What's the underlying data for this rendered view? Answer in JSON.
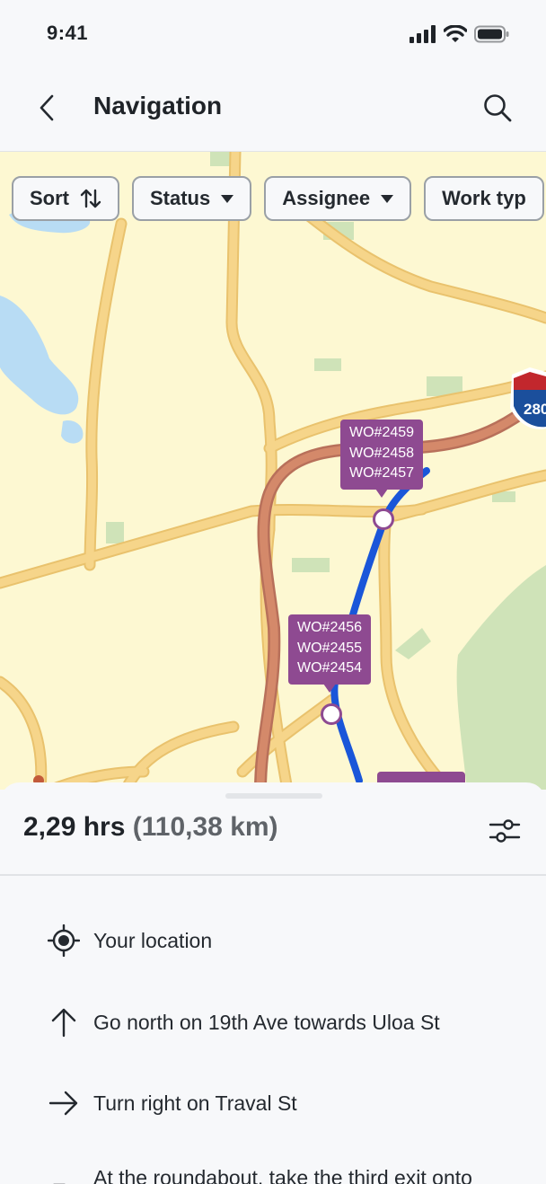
{
  "status_bar": {
    "time": "9:41"
  },
  "header": {
    "title": "Navigation"
  },
  "filters": [
    {
      "label": "Sort",
      "icon": "sort-arrows-icon"
    },
    {
      "label": "Status",
      "icon": "caret-down-icon"
    },
    {
      "label": "Assignee",
      "icon": "caret-down-icon"
    },
    {
      "label": "Work typ",
      "icon": "none"
    }
  ],
  "map": {
    "highway_shield": "280",
    "work_order_groups": [
      {
        "orders": [
          "WO#2459",
          "WO#2458",
          "WO#2457"
        ]
      },
      {
        "orders": [
          "WO#2456",
          "WO#2455",
          "WO#2454"
        ]
      }
    ],
    "colors": {
      "route": "#1a56d9",
      "traffic": "#d4896a",
      "marker": "#8e4a91",
      "land": "#fdf8d2",
      "water": "#b8dcf4",
      "park": "#cfe3b8",
      "road": "#f6d58a"
    }
  },
  "summary": {
    "duration": "2,29 hrs",
    "distance": "(110,38 km)"
  },
  "steps": [
    {
      "icon": "my-location-icon",
      "text": "Your location"
    },
    {
      "icon": "arrow-up-icon",
      "text": "Go north on 19th Ave towards Uloa St"
    },
    {
      "icon": "arrow-right-icon",
      "text": "Turn right on Traval St"
    },
    {
      "icon": "roundabout-icon",
      "text": "At the roundabout, take the third exit onto"
    }
  ]
}
